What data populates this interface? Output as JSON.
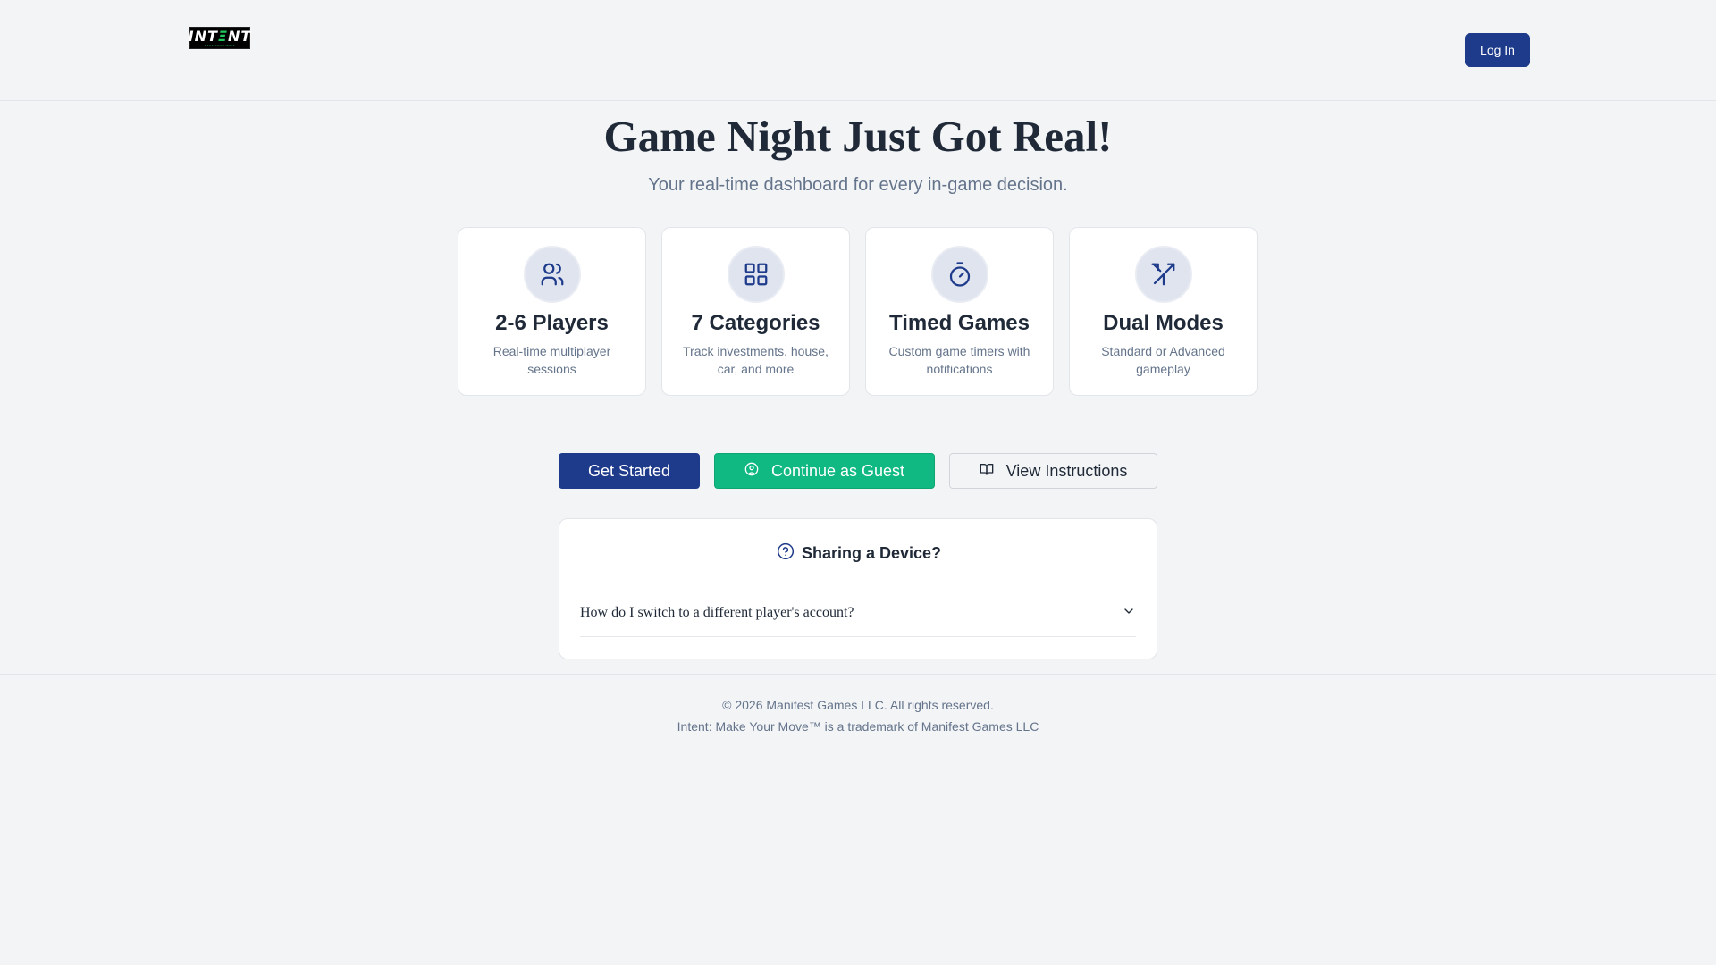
{
  "header": {
    "logo_text_main": "INT",
    "logo_text_accent": "Ξ",
    "logo_text_end": "NT",
    "logo_tagline": "MAKE YOUR MOVE",
    "login_label": "Log In"
  },
  "hero": {
    "title": "Game Night Just Got Real!",
    "subtitle": "Your real-time dashboard for every in-game decision."
  },
  "features": [
    {
      "icon": "users-icon",
      "title": "2-6 Players",
      "desc": "Real-time multiplayer sessions"
    },
    {
      "icon": "grid-icon",
      "title": "7 Categories",
      "desc": "Track investments, house, car, and more"
    },
    {
      "icon": "timer-icon",
      "title": "Timed Games",
      "desc": "Custom game timers with notifications"
    },
    {
      "icon": "split-arrows-icon",
      "title": "Dual Modes",
      "desc": "Standard or Advanced gameplay"
    }
  ],
  "actions": {
    "get_started": "Get Started",
    "guest": "Continue as Guest",
    "instructions": "View Instructions"
  },
  "faq": {
    "heading": "Sharing a Device?",
    "items": [
      {
        "question": "How do I switch to a different player's account?"
      }
    ]
  },
  "footer": {
    "copyright": "© 2026 Manifest Games LLC. All rights reserved.",
    "trademark": "Intent: Make Your Move™ is a trademark of Manifest Games LLC"
  },
  "colors": {
    "primary": "#1e3a8a",
    "guest": "#10b981",
    "background": "#f3f4f6"
  }
}
